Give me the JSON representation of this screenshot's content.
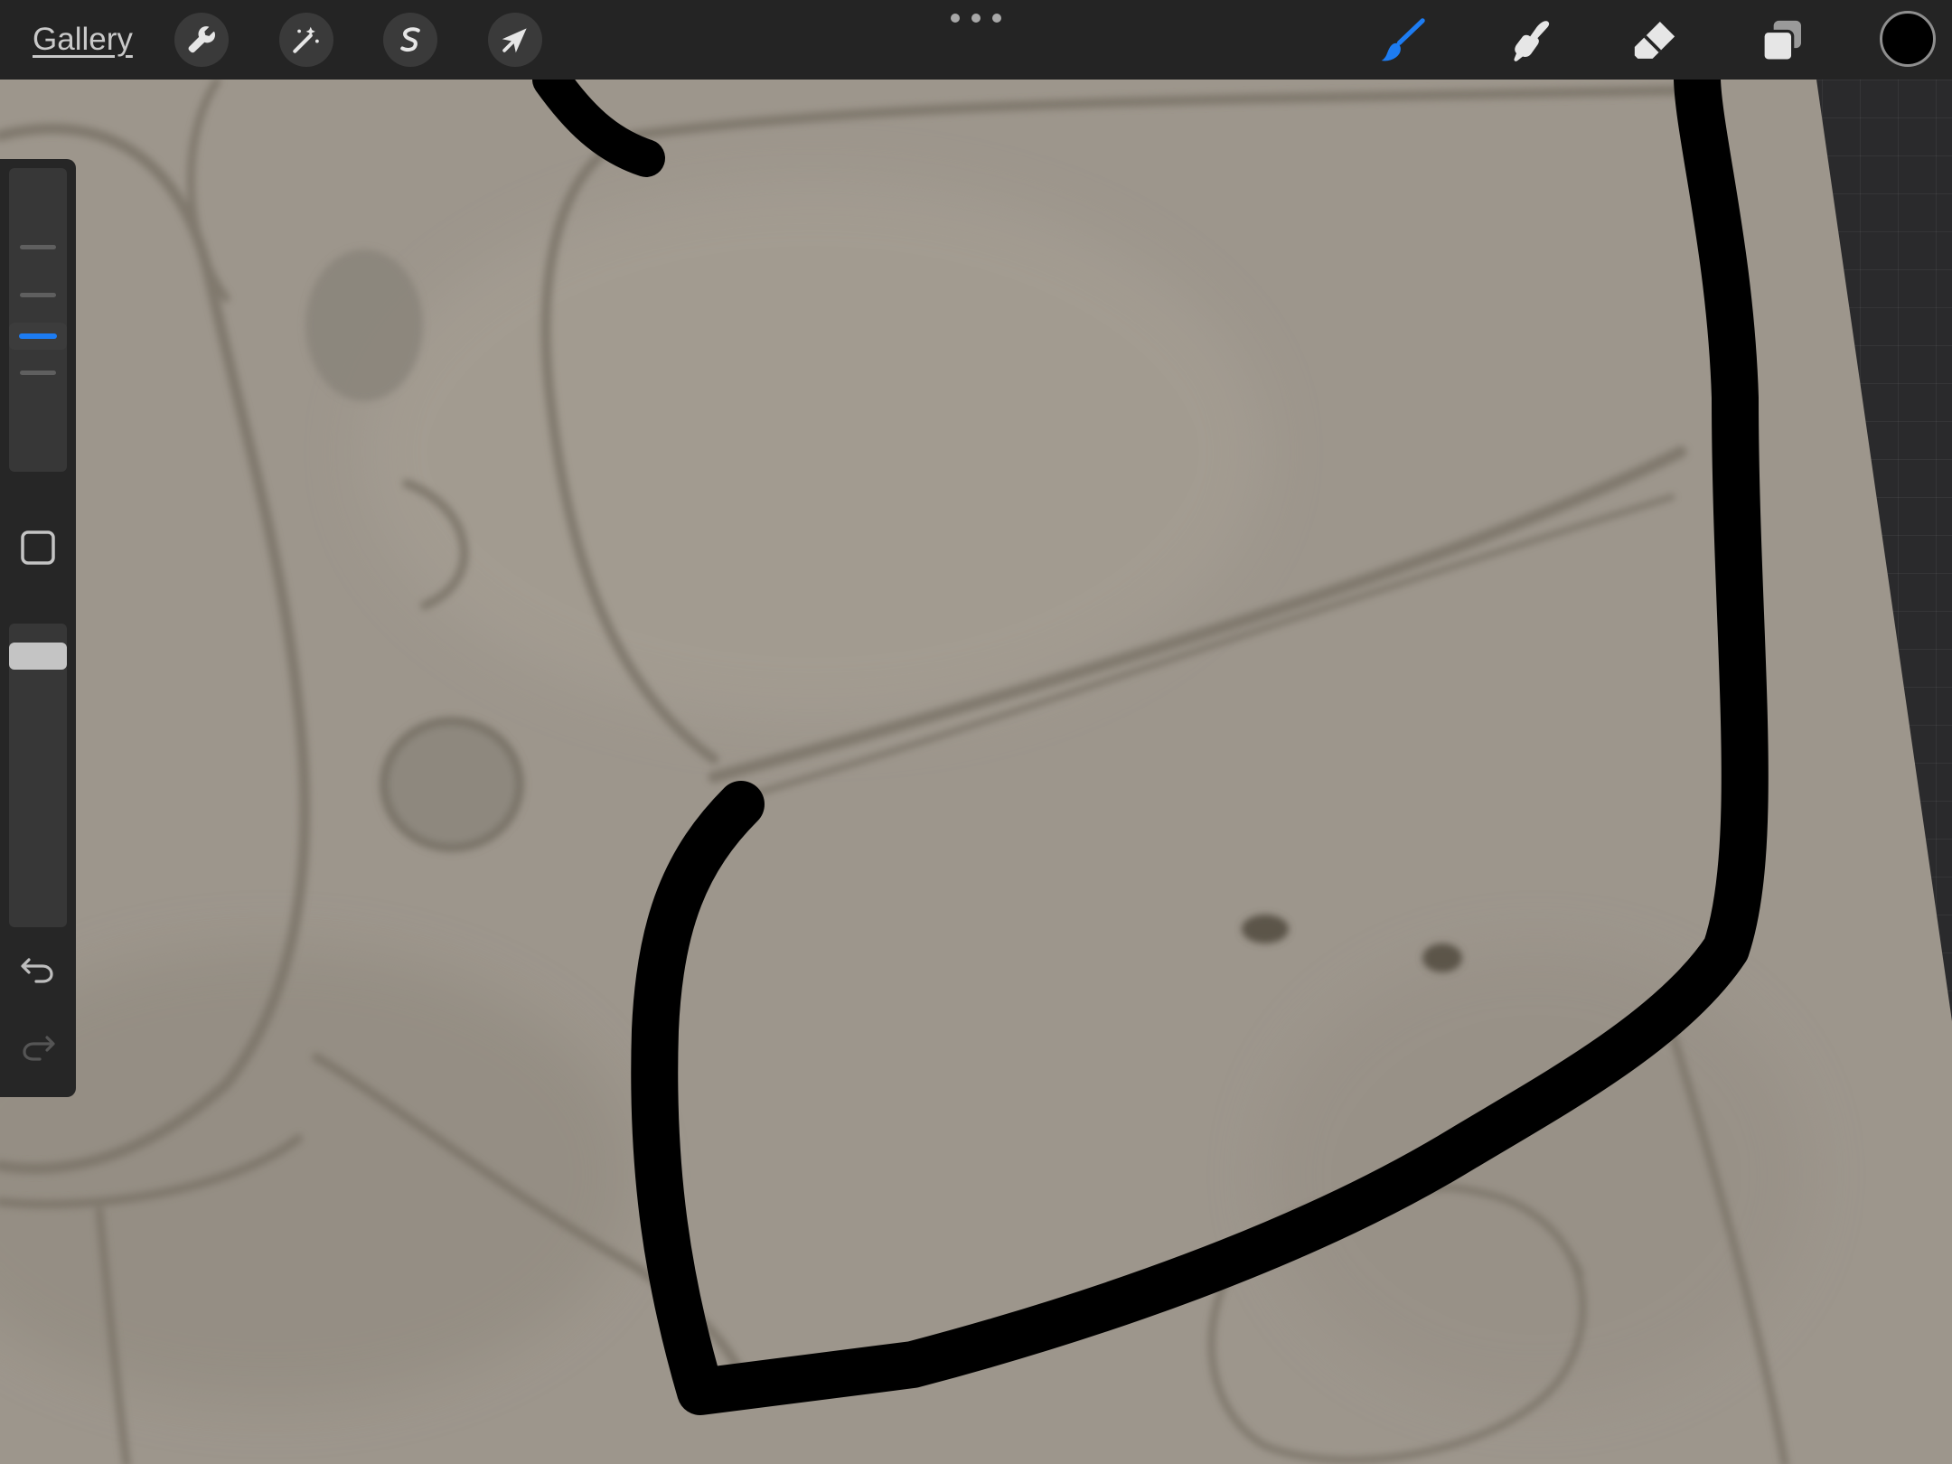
{
  "toolbar": {
    "gallery_label": "Gallery",
    "left_tools": [
      {
        "name": "actions",
        "icon": "wrench-icon"
      },
      {
        "name": "adjustments",
        "icon": "magic-wand-icon"
      },
      {
        "name": "selection",
        "icon": "selection-s-icon"
      },
      {
        "name": "transform",
        "icon": "arrow-cursor-icon"
      }
    ],
    "more_menu_icon": "ellipsis-icon",
    "right_tools": [
      {
        "name": "brush",
        "icon": "brush-icon",
        "active": true
      },
      {
        "name": "smudge",
        "icon": "smudge-finger-icon",
        "active": false
      },
      {
        "name": "eraser",
        "icon": "eraser-icon",
        "active": false
      },
      {
        "name": "layers",
        "icon": "layers-icon",
        "active": false
      }
    ],
    "current_color": "#000000"
  },
  "sidebar": {
    "brush_size_level": 0.44,
    "opacity_level": 0.93,
    "modify_icon": "square-icon",
    "undo_icon": "undo-arrow-icon",
    "redo_icon": "redo-arrow-icon",
    "redo_enabled": false
  },
  "colors": {
    "accent": "#1d7cf2",
    "toolbar_bg": "#242424",
    "paper": "#9d968c",
    "ink": "#000000"
  }
}
